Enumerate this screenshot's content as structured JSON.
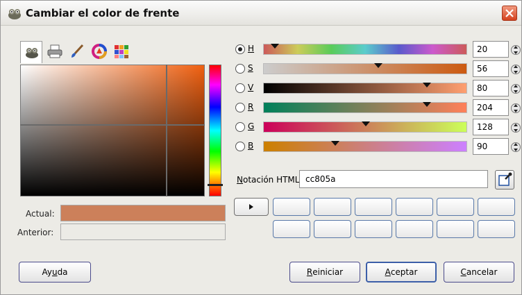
{
  "window": {
    "title": "Cambiar el color de frente"
  },
  "tabs": [
    {
      "name": "gimp-selector",
      "icon": "wilber-icon",
      "active": true
    },
    {
      "name": "cmyk-selector",
      "icon": "printer-icon",
      "active": false
    },
    {
      "name": "watercolor-selector",
      "icon": "brush-icon",
      "active": false
    },
    {
      "name": "wheel-selector",
      "icon": "color-wheel-icon",
      "active": false
    },
    {
      "name": "palette-selector",
      "icon": "palette-icon",
      "active": false
    }
  ],
  "color_area": {
    "hue_color": "#f06010"
  },
  "labels": {
    "current": "Actual:",
    "previous": "Anterior:"
  },
  "colors": {
    "current": "#cc805a",
    "previous": "#ecebe6",
    "accent": "#3c5fa8"
  },
  "channels": [
    {
      "key": "H",
      "value": "20",
      "selected": true,
      "level": 0.055,
      "gradient": "linear-gradient(to right,#cc5a5a,#cccc5a,#5acc5a,#5acccc,#5a5acc,#cc5acc,#cc5a5a)"
    },
    {
      "key": "S",
      "value": "56",
      "selected": false,
      "level": 0.56,
      "gradient": "linear-gradient(to right,#cccccc,#cc5a10)"
    },
    {
      "key": "V",
      "value": "80",
      "selected": false,
      "level": 0.8,
      "gradient": "linear-gradient(to right,#000000,#ff9f70)"
    },
    {
      "key": "R",
      "value": "204",
      "selected": false,
      "level": 0.8,
      "gradient": "linear-gradient(to right,#00805a,#ff805a)"
    },
    {
      "key": "G",
      "value": "128",
      "selected": false,
      "level": 0.5,
      "gradient": "linear-gradient(to right,#cc005a,#ccff5a)"
    },
    {
      "key": "B",
      "value": "90",
      "selected": false,
      "level": 0.35,
      "gradient": "linear-gradient(to right,#cc8000,#cc80ff)"
    }
  ],
  "html_notation": {
    "label": "Notación HTML:",
    "value": "cc805a"
  },
  "buttons": {
    "help": {
      "pre": "Ay",
      "u": "u",
      "post": "da"
    },
    "reset": {
      "pre": "",
      "u": "R",
      "post": "einiciar"
    },
    "accept": {
      "pre": "",
      "u": "A",
      "post": "ceptar"
    },
    "cancel": {
      "pre": "",
      "u": "C",
      "post": "ancelar"
    }
  }
}
